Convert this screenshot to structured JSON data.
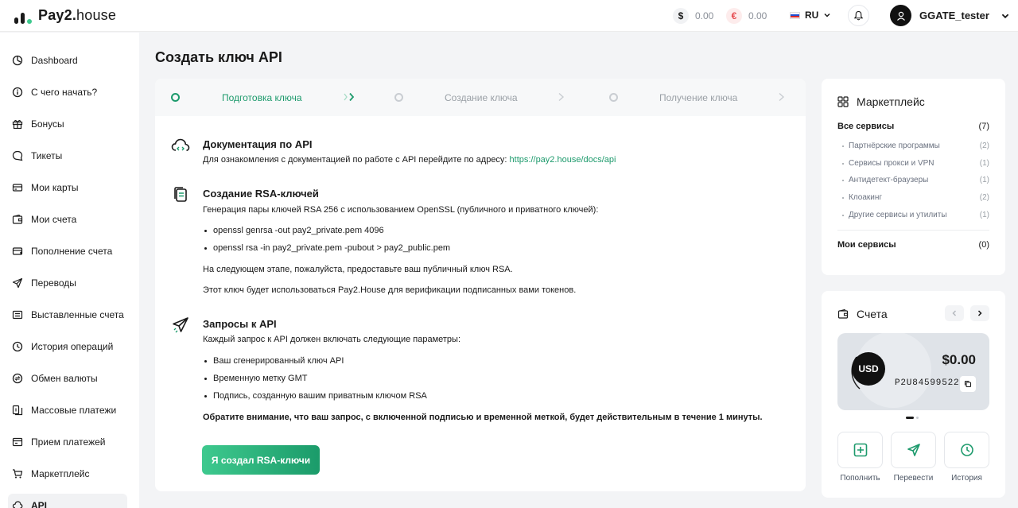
{
  "header": {
    "logo_bold": "Pay2.",
    "logo_light": "house",
    "balance_usd": "0.00",
    "balance_eur": "0.00",
    "usd_symbol": "$",
    "eur_symbol": "€",
    "language": "RU",
    "username": "GGATE_tester"
  },
  "sidebar": {
    "items": [
      {
        "label": "Dashboard",
        "icon": "dashboard-icon"
      },
      {
        "label": "С чего начать?",
        "icon": "info-icon"
      },
      {
        "label": "Бонусы",
        "icon": "gift-icon"
      },
      {
        "label": "Тикеты",
        "icon": "chat-icon"
      },
      {
        "label": "Мои карты",
        "icon": "card-icon"
      },
      {
        "label": "Мои счета",
        "icon": "wallet-icon"
      },
      {
        "label": "Пополнение счета",
        "icon": "topup-icon"
      },
      {
        "label": "Переводы",
        "icon": "send-icon"
      },
      {
        "label": "Выставленные счета",
        "icon": "invoice-icon"
      },
      {
        "label": "История операций",
        "icon": "history-icon"
      },
      {
        "label": "Обмен валюты",
        "icon": "exchange-icon"
      },
      {
        "label": "Массовые платежи",
        "icon": "mass-payments-icon"
      },
      {
        "label": "Прием платежей",
        "icon": "receive-icon"
      },
      {
        "label": "Маркетплейс",
        "icon": "cart-icon"
      },
      {
        "label": "API",
        "icon": "api-icon"
      }
    ]
  },
  "main": {
    "title": "Создать ключ API",
    "steps": [
      "Подготовка ключа",
      "Создание ключа",
      "Получение ключа"
    ],
    "docs": {
      "title": "Документация по API",
      "text": "Для ознакомления с документацией по работе с API перейдите по адресу: ",
      "link": "https://pay2.house/docs/api"
    },
    "rsa": {
      "title": "Создание RSA-ключей",
      "text": "Генерация пары ключей RSA 256 с использованием OpenSSL (публичного и приватного ключей):",
      "bullets": [
        "openssl genrsa -out pay2_private.pem 4096",
        "openssl rsa -in pay2_private.pem -pubout > pay2_public.pem"
      ],
      "note1": "На следующем этапе, пожалуйста, предоставьте ваш публичный ключ RSA.",
      "note2": "Этот ключ будет использоваться Pay2.House для верификации подписанных вами токенов."
    },
    "requests": {
      "title": "Запросы к API",
      "text": "Каждый запрос к API должен включать следующие параметры:",
      "bullets": [
        "Ваш сгенерированный ключ API",
        "Временную метку GMT",
        "Подпись, созданную вашим приватным ключом RSA"
      ],
      "warning": "Обратите внимание, что ваш запрос, с включенной подписью и временной меткой, будет действительным в течение 1 минуты."
    },
    "button": "Я создал RSA-ключи"
  },
  "marketplace": {
    "title": "Маркетплейс",
    "all_label": "Все сервисы",
    "all_count": "(7)",
    "items": [
      {
        "label": "Партнёрские программы",
        "count": "(2)"
      },
      {
        "label": "Сервисы прокси и VPN",
        "count": "(1)"
      },
      {
        "label": "Антидетект-браузеры",
        "count": "(1)"
      },
      {
        "label": "Клоакинг",
        "count": "(2)"
      },
      {
        "label": "Другие сервисы и утилиты",
        "count": "(1)"
      }
    ],
    "my_label": "Мои сервисы",
    "my_count": "(0)"
  },
  "accounts": {
    "title": "Счета",
    "currency": "USD",
    "amount": "$0.00",
    "number": "P2U84599522",
    "actions": [
      "Пополнить",
      "Перевести",
      "История"
    ]
  },
  "colors": {
    "accent": "#1d9a6c",
    "usd_bg": "#f1f2f4",
    "eur_bg": "#fdecec",
    "eur_fg": "#e5484d"
  }
}
